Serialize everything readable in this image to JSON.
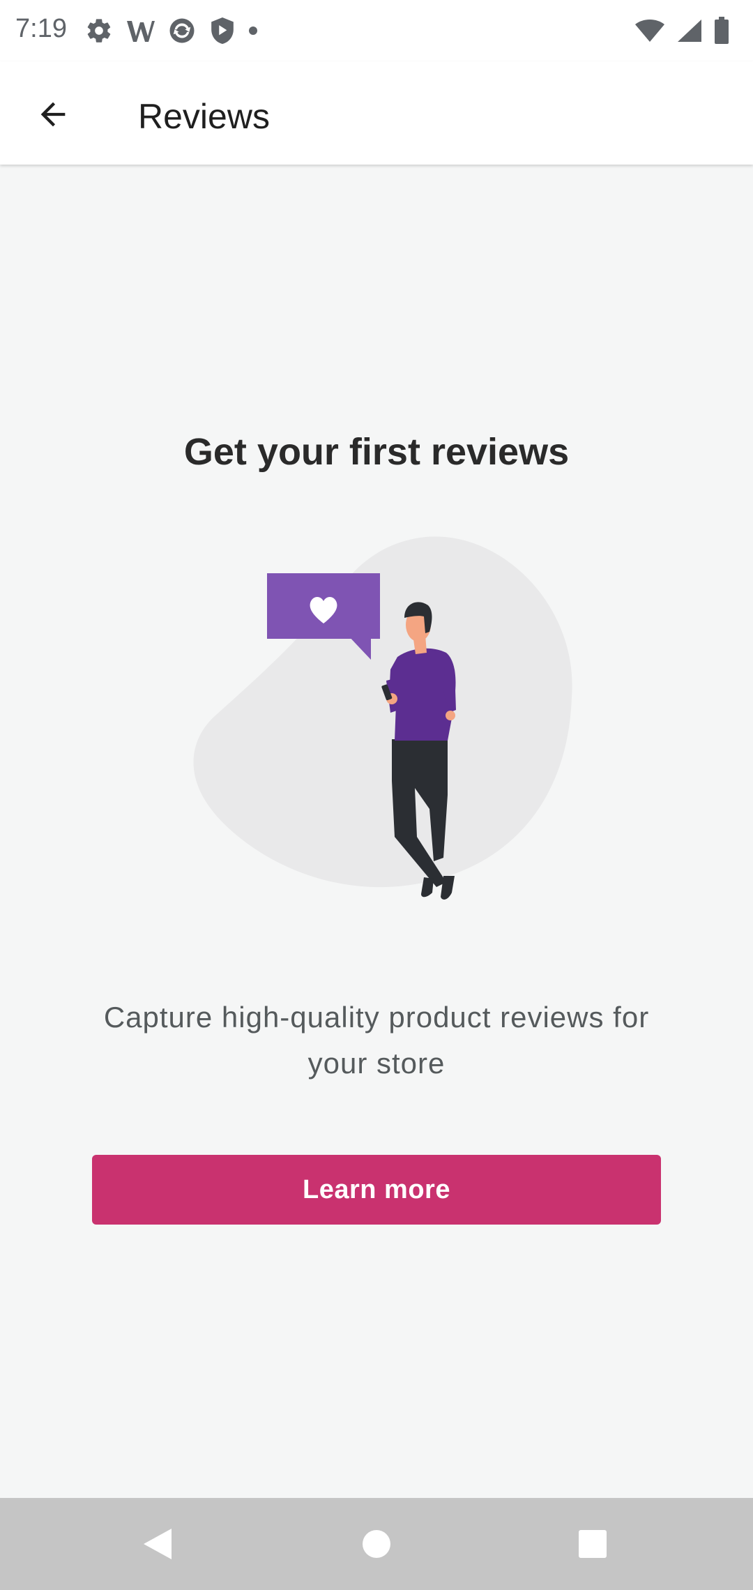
{
  "status_bar": {
    "time": "7:19",
    "left_icons": [
      "settings-icon",
      "wordpress-icon",
      "sync-icon",
      "shield-play-icon",
      "dot-icon"
    ],
    "right_icons": [
      "wifi-icon",
      "signal-icon",
      "battery-icon"
    ]
  },
  "app_bar": {
    "title": "Reviews",
    "back_icon": "arrow-back-icon"
  },
  "empty_state": {
    "title": "Get your first reviews",
    "description": "Capture high-quality product reviews for your store",
    "button_label": "Learn more",
    "illustration": "person-with-heart-speech-bubble"
  },
  "nav_bar": {
    "icons": [
      "back-triangle-icon",
      "home-circle-icon",
      "recents-square-icon"
    ]
  },
  "colors": {
    "accent": "#c9326f",
    "illustration_purple": "#7f54b3",
    "shirt_purple": "#5c2e91",
    "background": "#f5f6f6"
  }
}
